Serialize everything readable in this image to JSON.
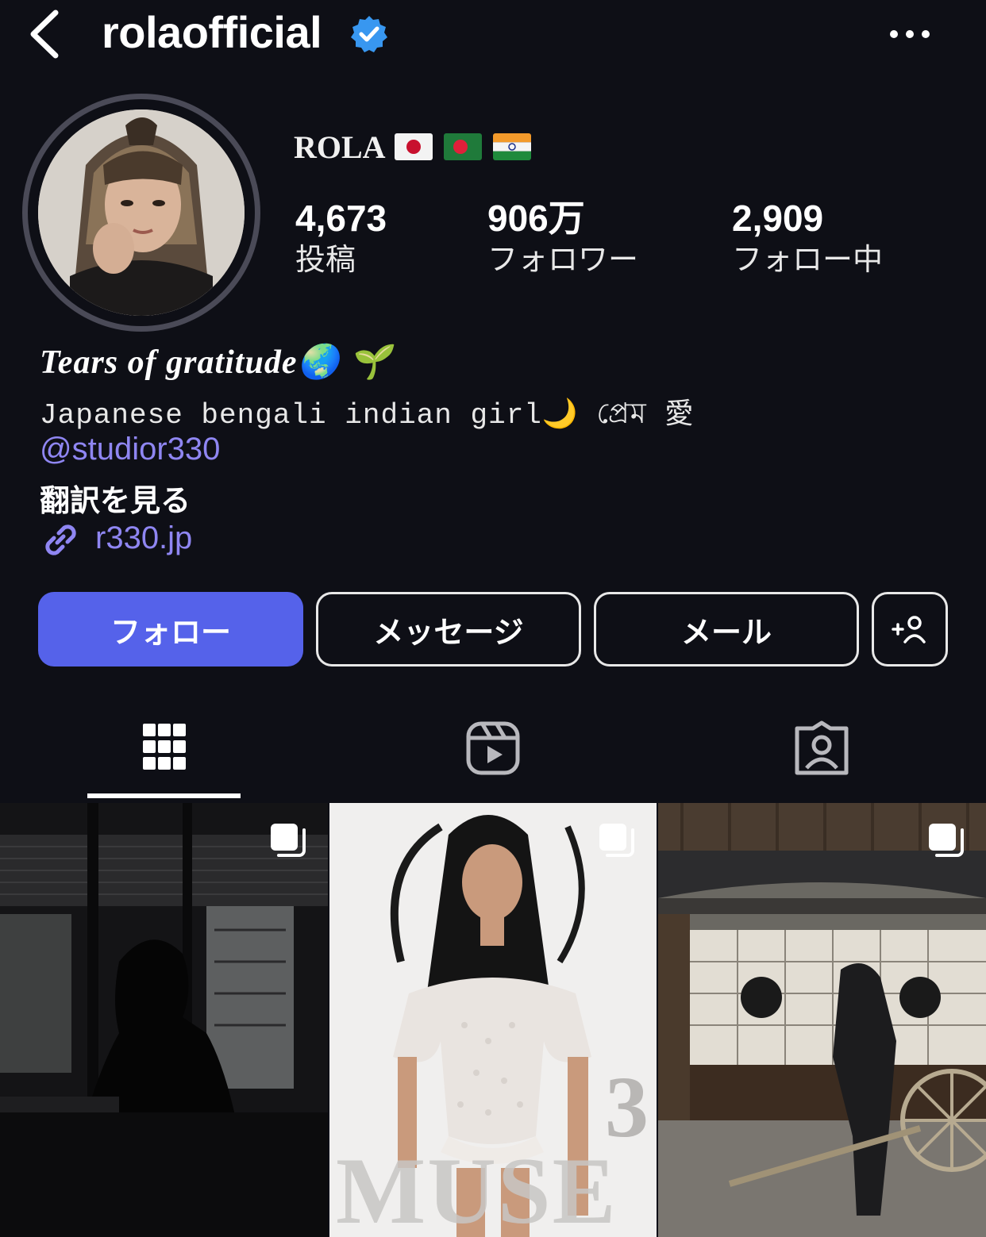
{
  "header": {
    "username": "rolaofficial"
  },
  "profile": {
    "display_name": "ROLA",
    "stats": [
      {
        "value": "4,673",
        "label": "投稿"
      },
      {
        "value": "906万",
        "label": "フォロワー"
      },
      {
        "value": "2,909",
        "label": "フォロー中"
      }
    ],
    "bio_title": "Tears of gratitude🌏 🌱",
    "bio_line": "Japanese bengali indian girl🌙 প্রেম 愛",
    "mention": "@studior330",
    "translate": "翻訳を見る",
    "link": "r330.jp"
  },
  "buttons": {
    "follow": "フォロー",
    "message": "メッセージ",
    "mail": "メール"
  },
  "posts": {
    "post2_number": "3",
    "post2_title": "MUSE"
  },
  "colors": {
    "background": "#0e0f16",
    "accent": "#5562ea",
    "link": "#8f86f2",
    "verified": "#3897f0"
  }
}
